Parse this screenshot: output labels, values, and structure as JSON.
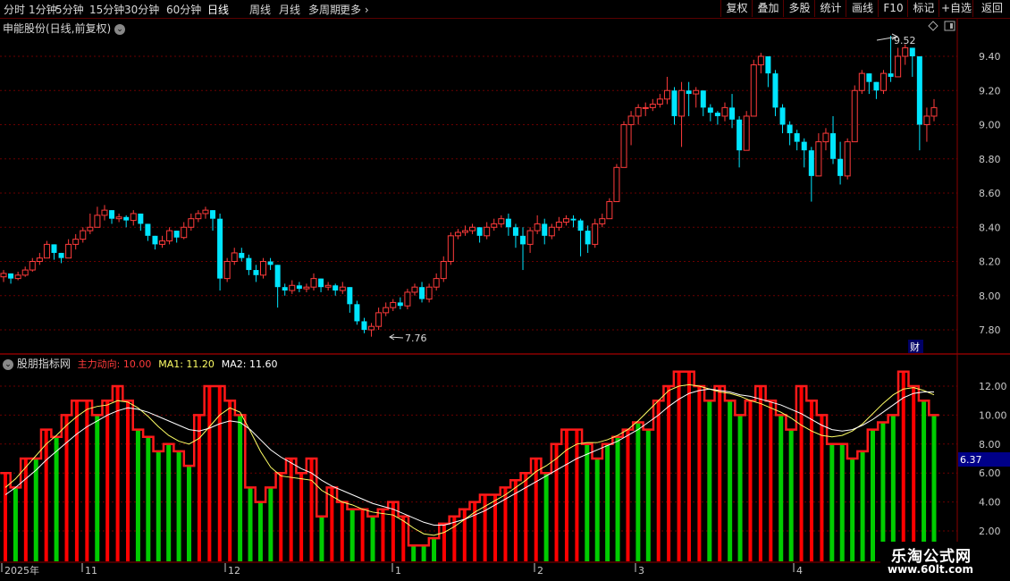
{
  "toolbar": {
    "periods": [
      "分时",
      "1分钟",
      "5分钟",
      "15分钟",
      "30分钟",
      "60分钟",
      "日线",
      "周线",
      "月线",
      "多周期",
      "更多"
    ],
    "active_period": "日线",
    "buttons": [
      "复权",
      "叠加",
      "多股",
      "统计",
      "画线",
      "F10",
      "标记",
      "+自选",
      "返回"
    ]
  },
  "main_panel": {
    "title": "申能股份(日线,前复权)",
    "high_label": "9.52",
    "low_label": "7.76",
    "fin_badge": "财"
  },
  "indicator_panel": {
    "name": "股朋指标网",
    "series_label": "主力动向: 10.00",
    "ma1_label": "MA1: 11.20",
    "ma2_label": "MA2: 11.60",
    "current_value_box": "6.37"
  },
  "x_axis_labels": [
    "2025年",
    "11",
    "12",
    "1",
    "2",
    "3",
    "4"
  ],
  "watermark": {
    "line1": "乐淘公式网",
    "line2": "www.60lt.com"
  },
  "colors": {
    "up": "#ff3b3b",
    "down": "#00e5ff",
    "bull_bar": "#ff0000",
    "bear_bar": "#00cc00",
    "ma1": "#ffff66",
    "ma2": "#ffffff",
    "grid": "#7a0000"
  },
  "chart_data": [
    {
      "type": "candlestick",
      "title": "申能股份(日线,前复权)",
      "y_ticks": [
        7.8,
        8.0,
        8.2,
        8.4,
        8.6,
        8.8,
        9.0,
        9.2,
        9.4
      ],
      "ylim": [
        7.7,
        9.6
      ],
      "grid": true,
      "annotations": [
        {
          "text": "9.52",
          "value": 9.52
        },
        {
          "text": "7.76",
          "value": 7.76
        }
      ],
      "close": [
        8.13,
        8.1,
        8.12,
        8.15,
        8.2,
        8.22,
        8.3,
        8.25,
        8.22,
        8.3,
        8.33,
        8.38,
        8.4,
        8.47,
        8.5,
        8.45,
        8.46,
        8.44,
        8.48,
        8.42,
        8.35,
        8.3,
        8.32,
        8.38,
        8.34,
        8.4,
        8.45,
        8.48,
        8.5,
        8.45,
        8.1,
        8.2,
        8.25,
        8.22,
        8.15,
        8.12,
        8.2,
        8.18,
        8.05,
        8.03,
        8.06,
        8.04,
        8.05,
        8.1,
        8.05,
        8.06,
        8.03,
        8.05,
        7.95,
        7.85,
        7.8,
        7.82,
        7.9,
        7.93,
        7.96,
        7.94,
        8.02,
        8.05,
        7.98,
        8.05,
        8.1,
        8.2,
        8.35,
        8.37,
        8.38,
        8.4,
        8.35,
        8.4,
        8.42,
        8.45,
        8.4,
        8.35,
        8.3,
        8.38,
        8.42,
        8.35,
        8.4,
        8.43,
        8.45,
        8.44,
        8.38,
        8.3,
        8.42,
        8.45,
        8.55,
        8.75,
        9.0,
        9.05,
        9.1,
        9.1,
        9.12,
        9.15,
        9.2,
        9.05,
        9.2,
        9.18,
        9.2,
        9.1,
        9.07,
        9.05,
        9.1,
        9.03,
        8.85,
        9.05,
        9.35,
        9.4,
        9.3,
        9.1,
        9.0,
        8.95,
        8.9,
        8.85,
        8.7,
        8.9,
        8.95,
        8.8,
        8.7,
        8.9,
        9.2,
        9.3,
        9.25,
        9.2,
        9.3,
        9.28,
        9.4,
        9.45,
        9.4,
        9.0,
        9.05,
        9.1
      ],
      "high": [
        8.15,
        8.13,
        8.14,
        8.17,
        8.22,
        8.25,
        8.32,
        8.28,
        8.24,
        8.33,
        8.36,
        8.4,
        8.48,
        8.52,
        8.53,
        8.48,
        8.48,
        8.47,
        8.5,
        8.45,
        8.4,
        8.33,
        8.35,
        8.4,
        8.38,
        8.43,
        8.48,
        8.5,
        8.52,
        8.48,
        8.48,
        8.22,
        8.28,
        8.28,
        8.24,
        8.18,
        8.22,
        8.22,
        8.18,
        8.07,
        8.09,
        8.08,
        8.07,
        8.13,
        8.1,
        8.08,
        8.07,
        8.08,
        8.05,
        7.97,
        7.87,
        7.84,
        7.93,
        7.96,
        7.98,
        7.99,
        8.04,
        8.07,
        8.08,
        8.07,
        8.13,
        8.23,
        8.37,
        8.39,
        8.41,
        8.42,
        8.4,
        8.43,
        8.45,
        8.47,
        8.48,
        8.42,
        8.4,
        8.4,
        8.47,
        8.45,
        8.42,
        8.46,
        8.47,
        8.47,
        8.45,
        8.41,
        8.45,
        8.48,
        8.57,
        8.77,
        9.02,
        9.08,
        9.12,
        9.13,
        9.15,
        9.18,
        9.28,
        9.22,
        9.25,
        9.25,
        9.22,
        9.2,
        9.12,
        9.08,
        9.13,
        9.18,
        9.05,
        9.08,
        9.38,
        9.42,
        9.4,
        9.32,
        9.12,
        9.02,
        8.97,
        8.92,
        8.87,
        8.95,
        8.98,
        9.05,
        8.9,
        8.92,
        9.23,
        9.32,
        9.3,
        9.25,
        9.32,
        9.52,
        9.45,
        9.47,
        9.42,
        9.4,
        9.1,
        9.15
      ],
      "low": [
        8.08,
        8.07,
        8.09,
        8.11,
        8.14,
        8.18,
        8.24,
        8.21,
        8.19,
        8.22,
        8.27,
        8.31,
        8.36,
        8.42,
        8.44,
        8.42,
        8.43,
        8.4,
        8.41,
        8.38,
        8.32,
        8.27,
        8.28,
        8.3,
        8.31,
        8.33,
        8.38,
        8.43,
        8.45,
        8.38,
        8.03,
        8.08,
        8.18,
        8.2,
        8.12,
        8.08,
        8.1,
        8.15,
        7.93,
        8.0,
        8.01,
        8.02,
        8.02,
        8.03,
        8.02,
        8.03,
        8.0,
        8.01,
        7.9,
        7.83,
        7.78,
        7.76,
        7.8,
        7.88,
        7.91,
        7.92,
        7.92,
        8.0,
        7.96,
        7.96,
        8.03,
        8.08,
        8.18,
        8.33,
        8.35,
        8.36,
        8.31,
        8.33,
        8.38,
        8.4,
        8.35,
        8.28,
        8.15,
        8.25,
        8.36,
        8.3,
        8.33,
        8.38,
        8.41,
        8.4,
        8.23,
        8.25,
        8.28,
        8.4,
        8.45,
        8.57,
        8.75,
        8.88,
        9.0,
        9.05,
        9.08,
        9.1,
        9.12,
        9.0,
        8.87,
        9.05,
        9.1,
        9.05,
        9.02,
        9.0,
        9.02,
        8.98,
        8.75,
        8.85,
        9.05,
        9.3,
        9.22,
        9.05,
        8.95,
        8.88,
        8.85,
        8.75,
        8.55,
        8.7,
        8.85,
        8.77,
        8.65,
        8.68,
        8.9,
        9.18,
        9.18,
        9.15,
        9.18,
        9.25,
        9.3,
        9.35,
        9.28,
        8.85,
        8.9,
        9.02
      ]
    },
    {
      "type": "bar",
      "title": "股朋指标网",
      "y_ticks": [
        2.0,
        4.0,
        6.0,
        8.0,
        10.0,
        12.0
      ],
      "ylim": [
        0.5,
        13.5
      ],
      "series": [
        {
          "name": "主力动向",
          "values": [
            6.0,
            5.0,
            7.0,
            7.0,
            9.0,
            8.5,
            10.0,
            11.0,
            11.0,
            10.0,
            11.0,
            12.0,
            11.0,
            9.0,
            8.5,
            7.5,
            8.0,
            7.5,
            6.5,
            10.0,
            12.0,
            12.0,
            11.0,
            10.0,
            5.0,
            4.0,
            5.0,
            6.0,
            7.0,
            6.0,
            7.0,
            3.0,
            5.0,
            4.0,
            3.5,
            3.5,
            3.0,
            3.5,
            4.0,
            3.0,
            1.0,
            1.0,
            1.5,
            2.5,
            3.0,
            3.5,
            4.0,
            4.5,
            4.5,
            5.0,
            5.5,
            6.0,
            7.0,
            6.0,
            8.0,
            9.0,
            9.0,
            8.0,
            7.0,
            8.0,
            8.5,
            9.0,
            9.5,
            9.0,
            11.0,
            12.0,
            13.0,
            13.0,
            12.0,
            11.0,
            12.0,
            11.0,
            10.0,
            11.0,
            12.0,
            11.0,
            10.0,
            9.0,
            12.0,
            11.0,
            10.0,
            8.0,
            8.0,
            7.0,
            7.5,
            9.0,
            9.5,
            10.0,
            13.0,
            12.0,
            11.0,
            10.0
          ]
        },
        {
          "name": "MA1",
          "values": [
            5.0,
            5.6,
            6.4,
            7.2,
            8.0,
            8.6,
            9.3,
            9.9,
            10.4,
            10.6,
            10.7,
            11.0,
            10.9,
            10.5,
            9.9,
            9.2,
            8.6,
            8.2,
            8.0,
            8.4,
            9.2,
            10.0,
            10.5,
            10.2,
            8.9,
            7.5,
            6.4,
            5.8,
            5.7,
            5.6,
            5.5,
            4.8,
            4.4,
            4.0,
            3.8,
            3.5,
            3.3,
            3.2,
            3.1,
            2.7,
            2.2,
            1.8,
            1.7,
            1.9,
            2.3,
            2.8,
            3.3,
            3.7,
            4.1,
            4.5,
            5.0,
            5.5,
            6.1,
            6.5,
            7.0,
            7.6,
            8.0,
            8.1,
            8.1,
            8.3,
            8.6,
            9.0,
            9.6,
            10.3,
            11.0,
            11.7,
            12.0,
            12.1,
            12.0,
            11.8,
            11.6,
            11.5,
            11.3,
            11.0,
            10.8,
            10.5,
            10.2,
            9.8,
            9.3,
            8.9,
            8.6,
            8.5,
            8.6,
            8.9,
            9.4,
            10.1,
            10.8,
            11.4,
            11.8,
            11.9,
            11.7,
            11.4
          ]
        },
        {
          "name": "MA2",
          "values": [
            4.5,
            5.0,
            5.6,
            6.2,
            6.9,
            7.5,
            8.1,
            8.7,
            9.2,
            9.6,
            10.0,
            10.3,
            10.5,
            10.4,
            10.2,
            9.9,
            9.6,
            9.3,
            9.0,
            8.9,
            9.1,
            9.4,
            9.6,
            9.5,
            9.0,
            8.3,
            7.6,
            7.1,
            6.7,
            6.3,
            6.0,
            5.5,
            5.1,
            4.8,
            4.5,
            4.2,
            3.9,
            3.7,
            3.5,
            3.2,
            2.9,
            2.6,
            2.4,
            2.4,
            2.6,
            2.8,
            3.1,
            3.4,
            3.8,
            4.2,
            4.6,
            5.0,
            5.4,
            5.8,
            6.2,
            6.6,
            7.0,
            7.3,
            7.6,
            7.9,
            8.2,
            8.6,
            9.0,
            9.5,
            10.0,
            10.6,
            11.1,
            11.5,
            11.7,
            11.8,
            11.7,
            11.6,
            11.4,
            11.3,
            11.1,
            10.9,
            10.7,
            10.4,
            10.1,
            9.7,
            9.3,
            9.0,
            8.9,
            9.0,
            9.3,
            9.7,
            10.2,
            10.7,
            11.2,
            11.5,
            11.6,
            11.6
          ]
        }
      ]
    }
  ]
}
